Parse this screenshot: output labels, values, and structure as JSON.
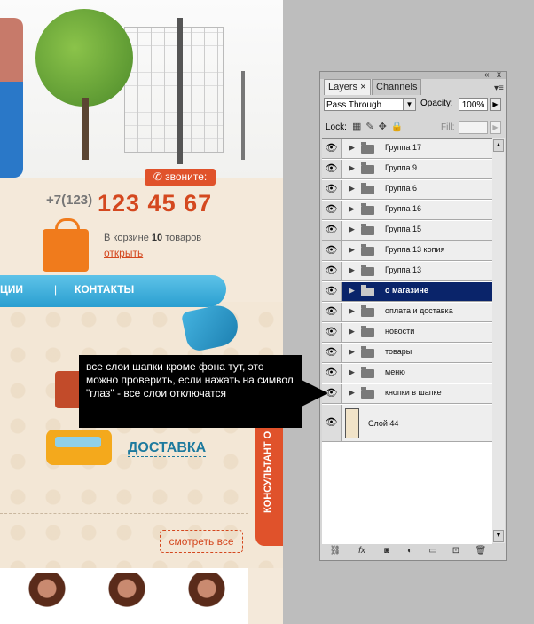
{
  "site": {
    "phone_button": "звоните:",
    "phone_prefix": "+7(123)",
    "phone_number": "123 45 67",
    "cart_prefix": "В корзине",
    "cart_count": "10",
    "cart_suffix": "товаров",
    "cart_link": "открыть",
    "nav_item_1": "ЦИИ",
    "nav_separator": "|",
    "nav_item_2": "КОНТАКТЫ",
    "delivery": "ДОСТАВКА",
    "consultant": "КОНСУЛЬТАНТ О",
    "see_all": "смотреть все"
  },
  "annotation": {
    "text": "все слои шапки кроме фона тут, это можно проверить, если нажать на символ \"глаз\" - все слои отключатся"
  },
  "panel": {
    "close": "«",
    "close_x": "x",
    "tabs": [
      "Layers",
      "Channels"
    ],
    "tab_close": "×",
    "blend_mode": "Pass Through",
    "opacity_label": "Opacity:",
    "opacity_value": "100%",
    "lock_label": "Lock:",
    "fill_label": "Fill:",
    "layers": [
      {
        "name": "Группа 17",
        "selected": false
      },
      {
        "name": "Группа 9",
        "selected": false
      },
      {
        "name": "Группа 6",
        "selected": false
      },
      {
        "name": "Группа 16",
        "selected": false
      },
      {
        "name": "Группа 15",
        "selected": false
      },
      {
        "name": "Группа 13 копия",
        "selected": false
      },
      {
        "name": "Группа 13",
        "selected": false
      },
      {
        "name": "о магазине",
        "selected": true
      },
      {
        "name": "оплата и доставка",
        "selected": false
      },
      {
        "name": "новости",
        "selected": false
      },
      {
        "name": "товары",
        "selected": false
      },
      {
        "name": "меню",
        "selected": false
      },
      {
        "name": "кнопки в шапке",
        "selected": false
      },
      {
        "name": "Слой 44",
        "selected": false
      }
    ]
  }
}
